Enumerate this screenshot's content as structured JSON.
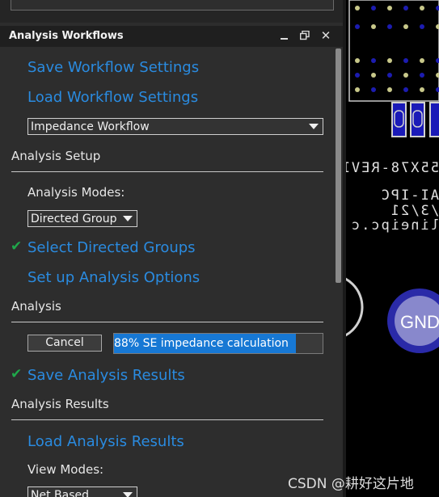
{
  "panel": {
    "title": "Analysis Workflows",
    "window_buttons": {
      "close": "✕"
    },
    "actions": {
      "save_settings": "Save Workflow Settings",
      "load_settings": "Load Workflow Settings"
    },
    "workflow_select": {
      "value": "Impedance Workflow"
    },
    "analysis_setup": {
      "heading": "Analysis Setup",
      "modes_label": "Analysis Modes:",
      "modes_select": {
        "value": "Directed Group"
      },
      "select_groups": "Select Directed Groups",
      "setup_options": "Set up Analysis Options"
    },
    "analysis": {
      "heading": "Analysis",
      "cancel_label": "Cancel",
      "progress_text": "88% SE impedance calculation",
      "progress_fraction": 0.88,
      "save_results": "Save Analysis Results"
    },
    "analysis_results": {
      "heading": "Analysis Results",
      "load_results": "Load Analysis Results",
      "view_modes_label": "View Modes:",
      "view_modes_select": {
        "value": "Net Based"
      }
    },
    "check_icon": "check-icon",
    "colors": {
      "link": "#2a8be0",
      "check": "#1fa84a",
      "progress": "#1778d4"
    }
  },
  "pcb": {
    "silkscreen_line1": "55X78-REVI",
    "silkscreen_line2": "AI-IPC",
    "silkscreen_line3": "/3/21",
    "silkscreen_line4": "lineipc.c",
    "gnd_label": "GND"
  },
  "watermark": "CSDN @耕好这片地"
}
